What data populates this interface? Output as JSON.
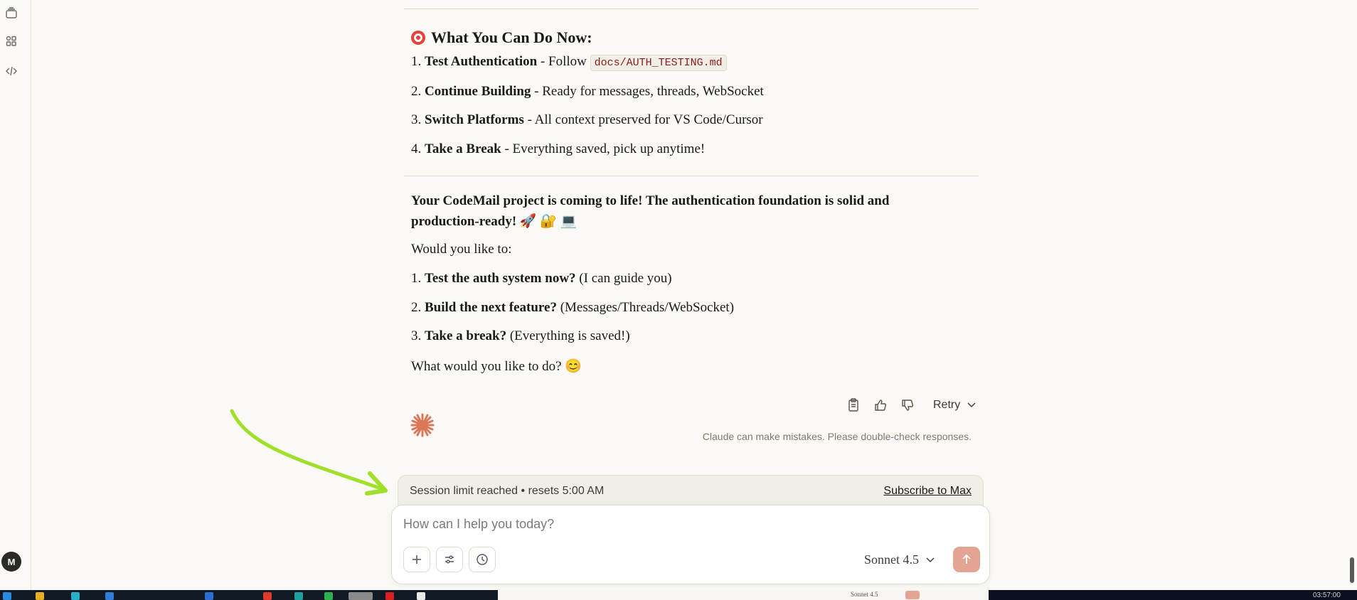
{
  "sidebar": {
    "icons": [
      "chats-icon",
      "projects-icon",
      "artifacts-icon"
    ],
    "avatar_initial": "M"
  },
  "message": {
    "heading": "What You Can Do Now:",
    "steps": [
      {
        "num": "1.",
        "title": "Test Authentication",
        "text": " - Follow ",
        "code": "docs/AUTH_TESTING.md"
      },
      {
        "num": "2.",
        "title": "Continue Building",
        "text": " - Ready for messages, threads, WebSocket"
      },
      {
        "num": "3.",
        "title": "Switch Platforms",
        "text": " - All context preserved for VS Code/Cursor"
      },
      {
        "num": "4.",
        "title": "Take a Break",
        "text": " - Everything saved, pick up anytime!"
      }
    ],
    "summary": "Your CodeMail project is coming to life! The authentication foundation is solid and production-ready! 🚀 🔐 💻",
    "prompt": "Would you like to:",
    "options": [
      {
        "num": "1.",
        "title": "Test the auth system now?",
        "text": " (I can guide you)"
      },
      {
        "num": "2.",
        "title": "Build the next feature?",
        "text": " (Messages/Threads/WebSocket)"
      },
      {
        "num": "3.",
        "title": "Take a break?",
        "text": " (Everything is saved!)"
      }
    ],
    "closing": "What would you like to do? 😊"
  },
  "actions": {
    "retry_label": "Retry",
    "disclaimer": "Claude can make mistakes. Please double-check responses."
  },
  "limit": {
    "text": "Session limit reached • resets 5:00 AM",
    "subscribe_label": "Subscribe to Max"
  },
  "composer": {
    "placeholder": "How can I help you today?",
    "value": "",
    "model_label": "Sonnet 4.5"
  },
  "taskbar": {
    "mini_model_label": "Sonnet 4.5",
    "clock": "03:57:00"
  },
  "colors": {
    "background": "#faf9f5",
    "accent": "#d97757",
    "send_button": "#e4a493",
    "annotation_arrow": "#9fe02a"
  }
}
